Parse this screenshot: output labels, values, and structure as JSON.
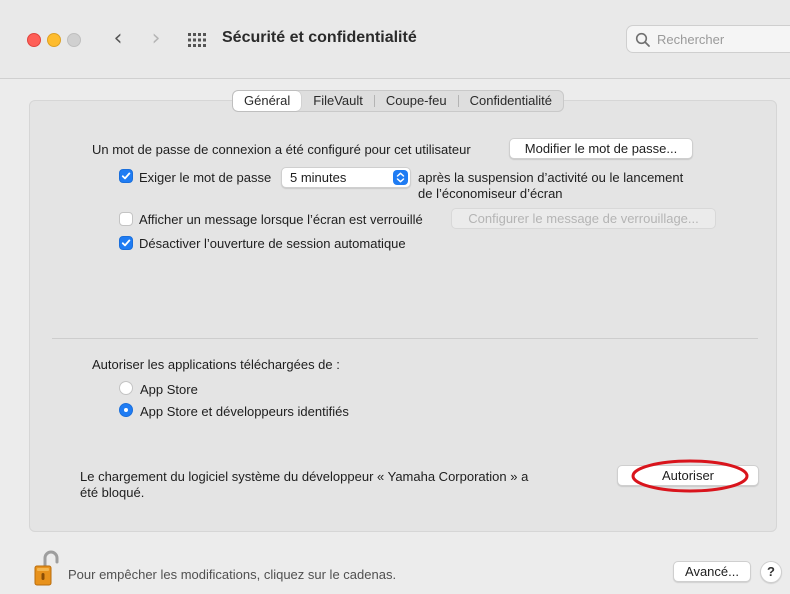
{
  "window": {
    "title": "Sécurité et confidentialité",
    "search_placeholder": "Rechercher"
  },
  "tabs": [
    {
      "label": "Général",
      "active": true
    },
    {
      "label": "FileVault",
      "active": false
    },
    {
      "label": "Coupe-feu",
      "active": false
    },
    {
      "label": "Confidentialité",
      "active": false
    }
  ],
  "general": {
    "password_set_text": "Un mot de passe de connexion a été configuré pour cet utilisateur",
    "change_password_button": "Modifier le mot de passe...",
    "require_password": {
      "label": "Exiger le mot de passe",
      "checked": true,
      "delay_value": "5 minutes",
      "suffix_line1": "après la suspension d’activité ou le lancement",
      "suffix_line2": "de l’économiseur d’écran"
    },
    "show_message": {
      "label": "Afficher un message lorsque l’écran est verrouillé",
      "checked": false,
      "button": "Configurer le message de verrouillage..."
    },
    "disable_auto_login": {
      "label": "Désactiver l’ouverture de session automatique",
      "checked": true
    },
    "allow_apps": {
      "heading": "Autoriser les applications téléchargées de :",
      "options": [
        {
          "label": "App Store",
          "selected": false
        },
        {
          "label": "App Store et développeurs identifiés",
          "selected": true
        }
      ]
    },
    "blocked": {
      "line1": "Le chargement du logiciel système du développeur « Yamaha Corporation » a",
      "line2": "été bloqué.",
      "button": "Autoriser"
    }
  },
  "footer": {
    "lock_text": "Pour empêcher les modifications, cliquez sur le cadenas.",
    "advanced_button": "Avancé...",
    "help_button": "?"
  },
  "colors": {
    "accent": "#1f7cf3",
    "highlight_ring": "#d9141c"
  }
}
